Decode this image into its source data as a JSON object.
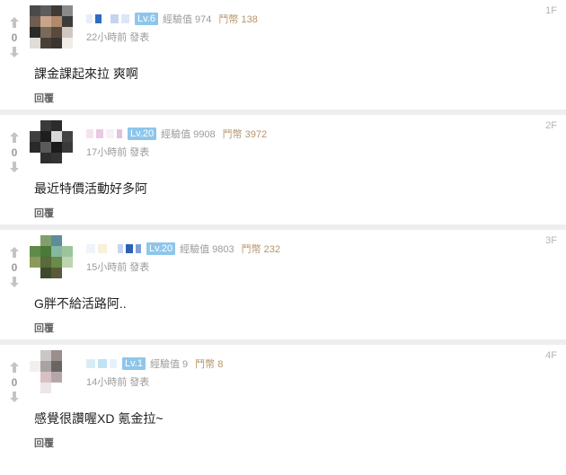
{
  "comments": [
    {
      "floor": "1F",
      "votes": "0",
      "level": "Lv.6",
      "exp": "經驗值 974",
      "gp": "鬥幣 138",
      "time": "22小時前 發表",
      "content": "課金課起來拉 爽啊",
      "reply": "回覆"
    },
    {
      "floor": "2F",
      "votes": "0",
      "level": "Lv.20",
      "exp": "經驗值 9908",
      "gp": "鬥幣 3972",
      "time": "17小時前 發表",
      "content": "最近特價活動好多阿",
      "reply": "回覆"
    },
    {
      "floor": "3F",
      "votes": "0",
      "level": "Lv.20",
      "exp": "經驗值 9803",
      "gp": "鬥幣 232",
      "time": "15小時前 發表",
      "content": "G胖不給活路阿..",
      "reply": "回覆"
    },
    {
      "floor": "4F",
      "votes": "0",
      "level": "Lv.1",
      "exp": "經驗值 9",
      "gp": "鬥幣 8",
      "time": "14小時前 發表",
      "content": "感覺很讚喔XD 氪金拉~",
      "reply": "回覆"
    }
  ],
  "icons": {
    "upvote": "arrow-up-icon",
    "downvote": "arrow-down-icon"
  },
  "colors": {
    "level_badge": "#8ec6ea",
    "gp_text": "#b5956a",
    "meta_text": "#9b9b9b",
    "separator": "#eeeeee"
  }
}
